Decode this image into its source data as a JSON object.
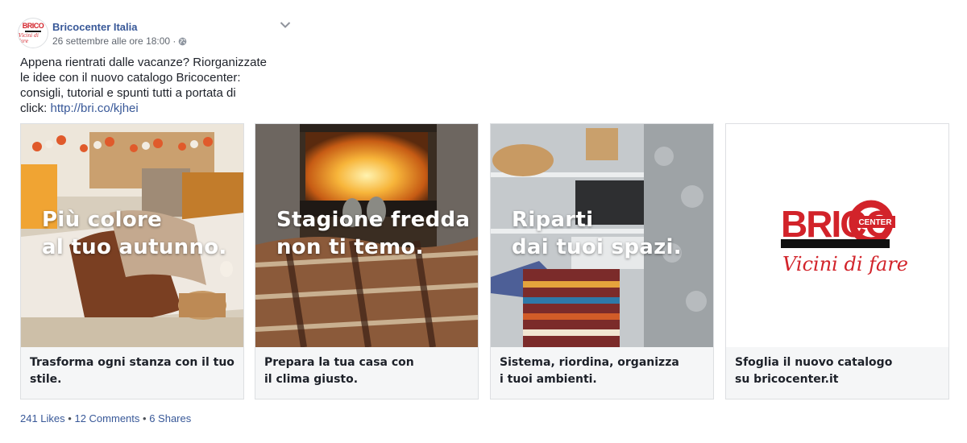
{
  "post": {
    "page_name": "Bricocenter Italia",
    "timestamp": "26 settembre alle ore 18:00 ·",
    "text_lines": [
      "Appena rientrati dalle vacanze? Riorganizzate",
      "le idee con il nuovo catalogo Bricocenter:",
      "consigli, tutorial e spunti tutti a portata di"
    ],
    "text_last_prefix": "click: ",
    "link": "http://bri.co/kjhei"
  },
  "avatar": {
    "brand": "BRICO",
    "tagline": "Vicini di fare"
  },
  "cards": [
    {
      "headline_lines": [
        "Più colore",
        "al tuo autunno."
      ],
      "caption_lines": [
        "Trasforma ogni stanza con il tuo stile."
      ]
    },
    {
      "headline_lines": [
        "Stagione fredda",
        "non ti temo."
      ],
      "caption_lines": [
        "Prepara la tua casa con",
        "il clima giusto."
      ]
    },
    {
      "headline_lines": [
        "Riparti",
        "dai tuoi spazi."
      ],
      "caption_lines": [
        "Sistema, riordina, organizza",
        "i tuoi ambienti."
      ]
    },
    {
      "logo": {
        "brand": "BRICO",
        "center": "CENTER",
        "tagline": "Vicini di fare"
      },
      "caption_lines": [
        "Sfoglia il nuovo catalogo",
        "su bricocenter.it"
      ]
    }
  ],
  "stats": {
    "likes": "241 Likes",
    "comments": "12 Comments",
    "shares": "6 Shares",
    "separator": "•"
  },
  "colors": {
    "link": "#385898",
    "brand_red": "#d2232a",
    "text": "#1d2129",
    "meta": "#616770"
  },
  "icons": [
    "globe-icon",
    "chevron-down-icon"
  ]
}
